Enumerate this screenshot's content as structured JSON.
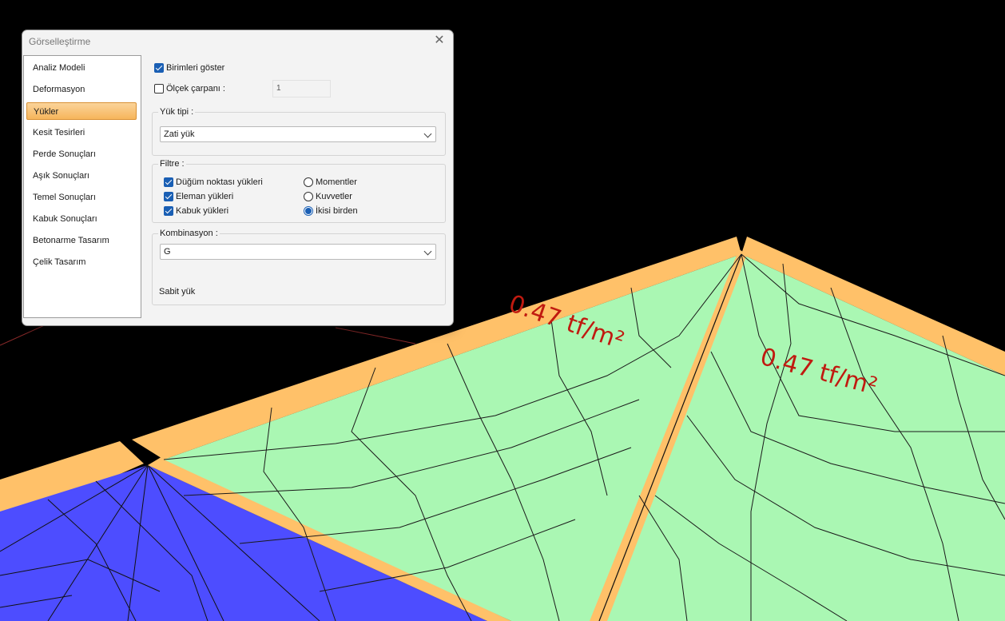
{
  "dialog": {
    "title": "Görselleştirme",
    "close_glyph": "✕",
    "nav": [
      "Analiz Modeli",
      "Deformasyon",
      "Yükler",
      "Kesit Tesirleri",
      "Perde Sonuçları",
      "Aşık Sonuçları",
      "Temel Sonuçları",
      "Kabuk Sonuçları",
      "Betonarme Tasarım",
      "Çelik Tasarım"
    ],
    "selected_nav": "Yükler",
    "show_units": {
      "label": "Birimleri göster",
      "checked": true
    },
    "scale_factor": {
      "label": "Ölçek çarpanı :",
      "checked": false,
      "value": "1"
    },
    "load_type": {
      "title": "Yük tipi :",
      "value": "Zati yük"
    },
    "filter": {
      "title": "Filtre :",
      "checks": [
        {
          "label": "Düğüm noktası yükleri",
          "checked": true
        },
        {
          "label": "Eleman yükleri",
          "checked": true
        },
        {
          "label": "Kabuk yükleri",
          "checked": true
        }
      ],
      "radios": [
        {
          "label": "Momentler",
          "selected": false
        },
        {
          "label": "Kuvvetler",
          "selected": false
        },
        {
          "label": "İkisi birden",
          "selected": true
        }
      ]
    },
    "combination": {
      "title": "Kombinasyon :",
      "value": "G",
      "description": "Sabit yük"
    }
  },
  "viewport": {
    "load_labels": [
      "0.47 tf/m²",
      "0.47 tf/m²"
    ],
    "colors": {
      "background": "#000000",
      "shell": "#aaf7b3",
      "edge": "#ffc169",
      "slab": "#4d4dff",
      "label": "#c01a10",
      "mesh": "#111111"
    }
  }
}
